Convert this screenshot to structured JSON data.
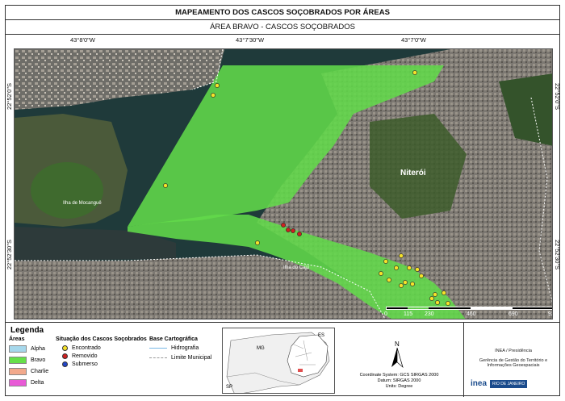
{
  "title": "MAPEAMENTO DOS CASCOS SOÇOBRADOS POR ÁREAS",
  "subtitle": "ÁREA BRAVO - CASCOS SOÇOBRADOS",
  "coords": {
    "top": [
      "43°8'0\"W",
      "43°7'30\"W",
      "43°7'0\"W"
    ],
    "left": [
      "22°52'0\"S",
      "22°52'30\"S"
    ],
    "right": [
      "22°52'0\"S",
      "22°52'30\"S"
    ]
  },
  "map_labels": {
    "niteroi": "Niterói",
    "mocangue": "Ilha de Mocanguê",
    "caju": "Ilha do Caju"
  },
  "scale": {
    "ticks": [
      "0",
      "115",
      "230",
      "460",
      "690",
      "920"
    ],
    "unit": "m"
  },
  "legend": {
    "title": "Legenda",
    "areas_title": "Áreas",
    "areas": [
      {
        "label": "Alpha",
        "color": "#a6d8ec"
      },
      {
        "label": "Bravo",
        "color": "#66e04a"
      },
      {
        "label": "Charlie",
        "color": "#f2a98c"
      },
      {
        "label": "Delta",
        "color": "#e85ad6"
      }
    ],
    "status_title": "Situação dos Cascos Soçobrados",
    "status": [
      {
        "label": "Encontrado",
        "color": "#f6e22a"
      },
      {
        "label": "Removido",
        "color": "#d02020"
      },
      {
        "label": "Submerso",
        "color": "#2246c8"
      }
    ],
    "base_title": "Base Cartográfica",
    "base": [
      {
        "label": "Hidrografia",
        "style": "line"
      },
      {
        "label": "Limite Municipal",
        "style": "dashed"
      }
    ]
  },
  "inset": {
    "labels": [
      "MG",
      "ES",
      "SP"
    ]
  },
  "projection": {
    "line1": "Coordinate System: GCS SIRGAS 2000",
    "line2": "Datum: SIRGAS 2000",
    "line3": "Units: Degree"
  },
  "north": "N",
  "credits": {
    "line1": "INEA / Presidência",
    "line2": "Gerência de Gestão do Território e",
    "line3": "Informações Geoespaciais",
    "logo_text": "inea",
    "gov_text": "RIO DE JANEIRO"
  },
  "points": {
    "encontrado": [
      [
        267,
        104
      ],
      [
        262,
        116
      ],
      [
        203,
        228
      ],
      [
        317,
        299
      ],
      [
        512,
        88
      ],
      [
        476,
        322
      ],
      [
        495,
        315
      ],
      [
        489,
        330
      ],
      [
        470,
        337
      ],
      [
        480,
        345
      ],
      [
        505,
        330
      ],
      [
        515,
        332
      ],
      [
        500,
        348
      ],
      [
        495,
        352
      ],
      [
        509,
        350
      ],
      [
        537,
        363
      ],
      [
        533,
        368
      ],
      [
        540,
        373
      ],
      [
        553,
        374
      ],
      [
        548,
        361
      ],
      [
        520,
        340
      ]
    ],
    "removido": [
      [
        355,
        283
      ],
      [
        361,
        284
      ],
      [
        369,
        288
      ],
      [
        349,
        277
      ]
    ]
  }
}
